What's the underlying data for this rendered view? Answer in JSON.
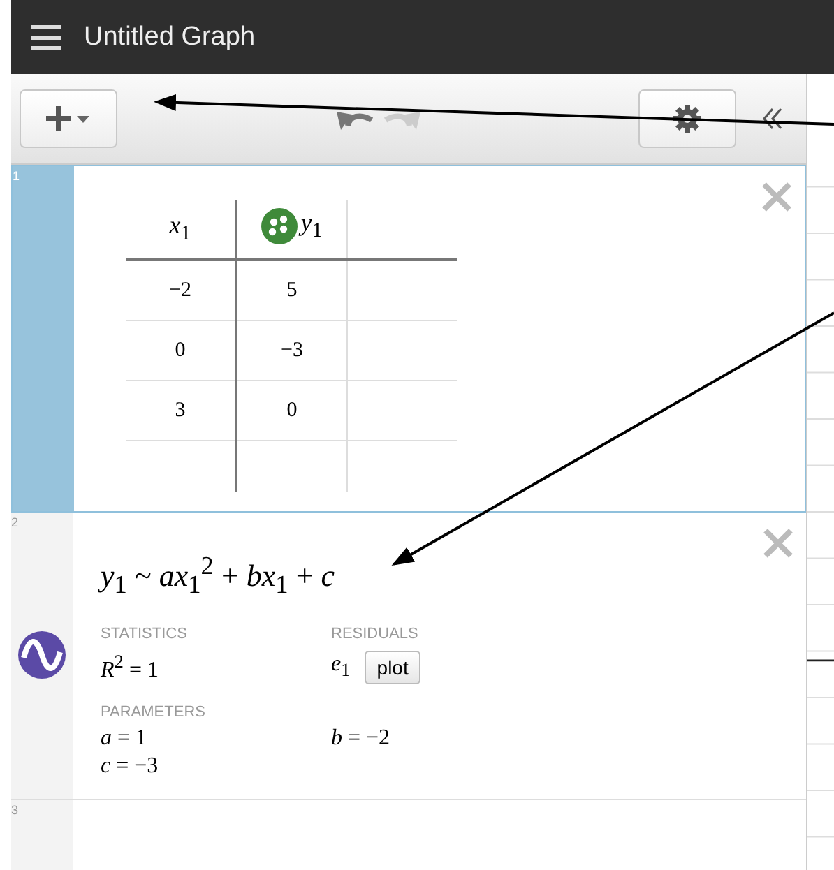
{
  "header": {
    "title": "Untitled Graph"
  },
  "expressions": [
    {
      "kind": "table",
      "number": "1",
      "selected": true,
      "columns": [
        {
          "header": "*x*$_{1}$"
        },
        {
          "header": "*y*$_{1}$",
          "color": "#3f8a3a"
        }
      ],
      "rows": [
        [
          "−2",
          "5"
        ],
        [
          "0",
          "−3"
        ],
        [
          "3",
          "0"
        ]
      ]
    },
    {
      "kind": "regression",
      "number": "2",
      "selected": false,
      "color": "#5b4aa6",
      "formula": "*y*$_{1}$ ~ *ax*$_{1}$$^{2}$ + *bx*$_{1}$ + *c*",
      "statistics_label": "STATISTICS",
      "statistic": "*R*$^{2}$ = 1",
      "residuals_label": "RESIDUALS",
      "residual": "*e*$_{1}$",
      "plot_button": "plot",
      "parameters_label": "PARAMETERS",
      "parameters": [
        "*a* = 1",
        "*b* = −2",
        "*c* = −3"
      ]
    },
    {
      "kind": "empty",
      "number": "3",
      "selected": false
    }
  ]
}
